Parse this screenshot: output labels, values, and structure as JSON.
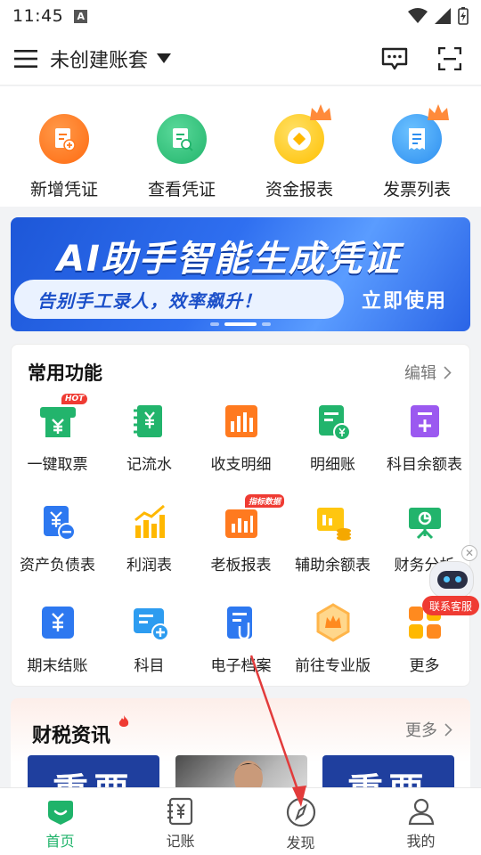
{
  "status_bar": {
    "time": "11:45",
    "notif_letter": "A"
  },
  "header": {
    "title": "未创建账套"
  },
  "quick_actions": [
    {
      "label": "新增凭证",
      "color": "#ff7a1f",
      "icon": "add-voucher-icon"
    },
    {
      "label": "查看凭证",
      "color": "#2cc07a",
      "icon": "view-voucher-icon"
    },
    {
      "label": "资金报表",
      "color": "#ffc60f",
      "icon": "fund-report-icon"
    },
    {
      "label": "发票列表",
      "color": "#2d9cf0",
      "icon": "invoice-list-icon"
    }
  ],
  "banner": {
    "title": "AI助手智能生成凭证",
    "subtitle": "告别手工录人，效率飙升！",
    "cta": "立即使用"
  },
  "common_functions": {
    "title": "常用功能",
    "edit": "编辑",
    "items": [
      {
        "label": "一键取票",
        "icon": "ticket-icon",
        "color": "#22b46c",
        "tag": "HOT"
      },
      {
        "label": "记流水",
        "icon": "ledger-icon",
        "color": "#22b46c"
      },
      {
        "label": "收支明细",
        "icon": "income-chart-icon",
        "color": "#ff7a1f"
      },
      {
        "label": "明细账",
        "icon": "detail-ledger-icon",
        "color": "#22b46c"
      },
      {
        "label": "科目余额表",
        "icon": "balance-doc-icon",
        "color": "#9b59f0"
      },
      {
        "label": "资产负债表",
        "icon": "asset-icon",
        "color": "#2d78f0"
      },
      {
        "label": "利润表",
        "icon": "profit-chart-icon",
        "color": "#ffb800"
      },
      {
        "label": "老板报表",
        "icon": "boss-report-icon",
        "color": "#ff7a1f",
        "tag": "指标数据"
      },
      {
        "label": "辅助余额表",
        "icon": "aux-balance-icon",
        "color": "#ffc60f"
      },
      {
        "label": "财务分析",
        "icon": "finance-analysis-icon",
        "color": "#22b46c"
      },
      {
        "label": "期末结账",
        "icon": "period-close-icon",
        "color": "#2d78f0"
      },
      {
        "label": "科目",
        "icon": "account-icon",
        "color": "#2d9cf0"
      },
      {
        "label": "电子档案",
        "icon": "e-archive-icon",
        "color": "#2d78f0"
      },
      {
        "label": "前往专业版",
        "icon": "pro-version-icon",
        "color": "#ffb54a"
      },
      {
        "label": "更多",
        "icon": "more-icon",
        "color": "#ff8a1f"
      }
    ]
  },
  "support_bot": {
    "label": "联系客服"
  },
  "news": {
    "title": "财税资讯",
    "more": "更多",
    "thumb1": "重要",
    "thumb3": "重要"
  },
  "bottom_nav": [
    {
      "label": "首页",
      "active": true
    },
    {
      "label": "记账",
      "active": false
    },
    {
      "label": "发现",
      "active": false
    },
    {
      "label": "我的",
      "active": false
    }
  ],
  "colors": {
    "brand_green": "#1fb36a",
    "accent_red": "#ef3b33",
    "banner_blue": "#2f6ff0"
  }
}
